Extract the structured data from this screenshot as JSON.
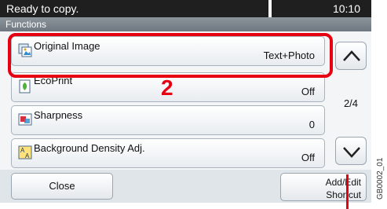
{
  "status": {
    "message": "Ready to copy.",
    "time": "10:10"
  },
  "header": {
    "title": "Functions"
  },
  "items": [
    {
      "label": "Original Image",
      "value": "Text+Photo",
      "icon": "original-image-icon"
    },
    {
      "label": "EcoPrint",
      "value": "Off",
      "icon": "ecoprint-icon"
    },
    {
      "label": "Sharpness",
      "value": "0",
      "icon": "sharpness-icon"
    },
    {
      "label": "Background Density Adj.",
      "value": "Off",
      "icon": "background-density-icon"
    }
  ],
  "annotation": {
    "step": "2"
  },
  "scroll": {
    "page_indicator": "2/4"
  },
  "buttons": {
    "close": "Close",
    "shortcut_line1": "Add/Edit",
    "shortcut_line2": "Shortcut"
  },
  "figure_code": "GB0002_01",
  "colors": {
    "highlight": "#e60012",
    "status_bg": "#1f1f1f"
  }
}
